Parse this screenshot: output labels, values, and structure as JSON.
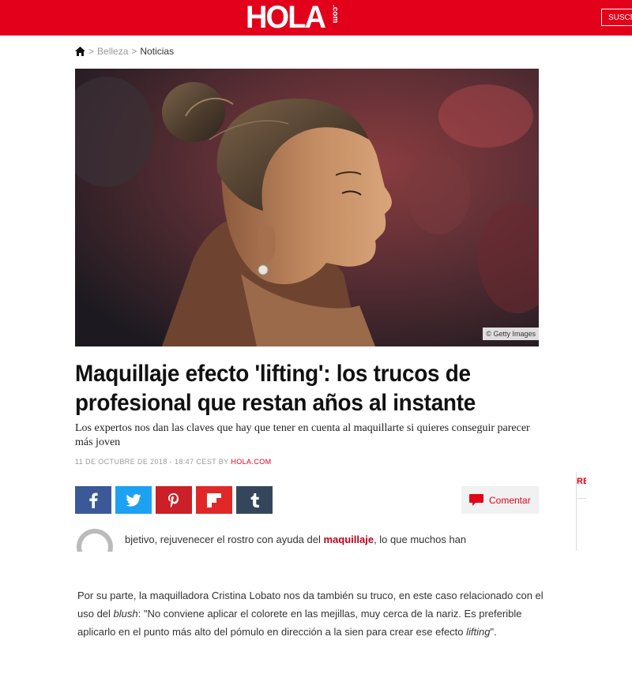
{
  "header": {
    "logo_main": "HOLA",
    "logo_suffix": ".com",
    "subscribe_label": "SUSCRÍBETE",
    "brand_color": "#e2001a"
  },
  "breadcrumb": {
    "home_icon": "home-icon",
    "items": [
      "Belleza",
      "Noticias"
    ],
    "separator": ">"
  },
  "hero": {
    "credit": "© Getty Images"
  },
  "article": {
    "title": "Maquillaje efecto 'lifting': los trucos de profesional que restan años al instante",
    "subtitle": "Los expertos nos dan las claves que hay que tener en cuenta al maquillarte si quieres conseguir parecer más joven",
    "date": "11 DE OCTUBRE DE 2018 - 18:47 CEST",
    "by_label": "BY",
    "author": "HOLA.COM",
    "para1": {
      "before": "bjetivo, rejuvenecer el rostro con ayuda del ",
      "link": "maquillaje",
      "after": ", lo que muchos han"
    },
    "para2": {
      "part1": "Por su parte, la maquilladora Cristina Lobato nos da también su truco, en este caso relacionado con el uso del ",
      "em1": "blush",
      "part2": ": \"No conviene aplicar el colorete en las mejillas, muy cerca de la nariz. Es preferible aplicarlo en el punto más alto del pómulo en dirección a la sien para crear ese efecto ",
      "em2": "lifting",
      "part3": "\"."
    }
  },
  "share": {
    "buttons": [
      {
        "name": "facebook",
        "icon": "facebook-icon",
        "color": "#3b5998"
      },
      {
        "name": "twitter",
        "icon": "twitter-icon",
        "color": "#1da1f2"
      },
      {
        "name": "pinterest",
        "icon": "pinterest-icon",
        "color": "#cb2027"
      },
      {
        "name": "flipboard",
        "icon": "flipboard-icon",
        "color": "#e12828"
      },
      {
        "name": "tumblr",
        "icon": "tumblr-icon",
        "color": "#35465c"
      }
    ],
    "comment_label": "Comentar"
  },
  "sidebar": {
    "teaser": "RE"
  }
}
